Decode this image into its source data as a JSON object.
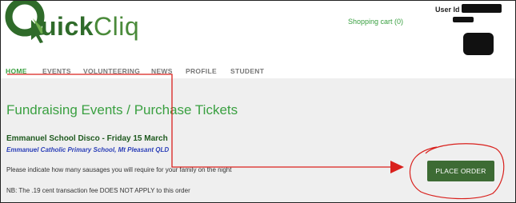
{
  "header": {
    "logo_main": "uick",
    "logo_suffix": "Cliq",
    "cart_label": "Shopping cart (0)",
    "user_id_label": "User Id"
  },
  "nav": {
    "items": [
      {
        "label": "HOME",
        "active": true
      },
      {
        "label": "EVENTS"
      },
      {
        "label": "VOLUNTEERING"
      },
      {
        "label": "NEWS"
      },
      {
        "label": "PROFILE"
      },
      {
        "label": "STUDENT"
      }
    ]
  },
  "main": {
    "page_title": "Fundraising Events / Purchase Tickets",
    "event_name": "Emmanuel School Disco - Friday 15 March",
    "event_school": "Emmanuel Catholic Primary School, Mt Pleasant QLD",
    "instruction": "Please indicate how many sausages you will require for your family on the night",
    "nb_note": "NB: The .19 cent transaction fee DOES NOT APPLY to this order",
    "place_order_label": "PLACE ORDER"
  },
  "colors": {
    "brand_green": "#3aa041",
    "dark_green": "#2f6b2a",
    "button_green": "#3d6b34",
    "annotation_red": "#d9201c",
    "school_blue": "#2b3fb8"
  }
}
